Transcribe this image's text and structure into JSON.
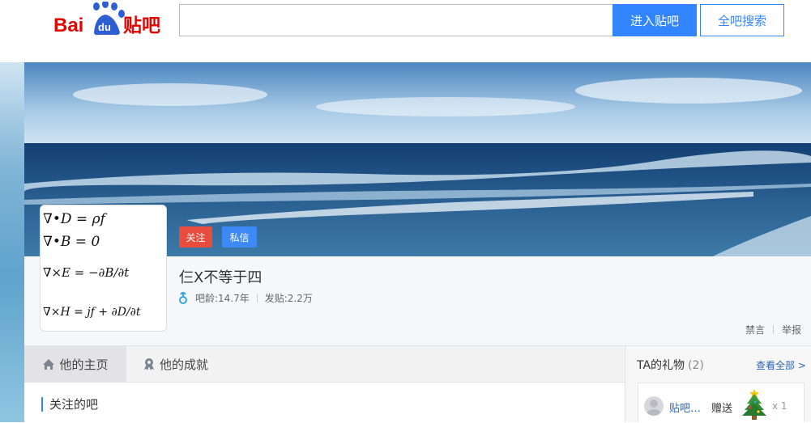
{
  "header": {
    "logo_text": "Bai du 贴吧",
    "search_placeholder": "",
    "enter_button": "进入贴吧",
    "search_all_button": "全吧搜索"
  },
  "profile": {
    "follow_button": "关注",
    "message_button": "私信",
    "username": "仨X不等于四",
    "gender_icon": "male-icon",
    "age": "吧龄:14.7年",
    "posts": "发贴:2.2万",
    "mute": "禁言",
    "report": "举报",
    "avatar_formulas": [
      "∇•D = ρf",
      "∇•B = 0",
      "∇×E = −∂B/∂t",
      "∇×H = jf + ∂D/∂t"
    ]
  },
  "tabs": [
    {
      "label": "他的主页",
      "icon": "home-icon",
      "active": true
    },
    {
      "label": "他的成就",
      "icon": "achievement-icon",
      "active": false
    }
  ],
  "main": {
    "section_title": "关注的吧"
  },
  "gifts": {
    "title": "TA的礼物",
    "count": "(2)",
    "view_all": "查看全部 >",
    "items": [
      {
        "user": "贴吧…",
        "verb": "赠送",
        "gift_icon": "christmas-tree-icon",
        "qty": "x 1"
      }
    ]
  },
  "colors": {
    "accent": "#3385ff",
    "follow": "#e74c3c",
    "message": "#3d8af7",
    "link": "#2d64b3"
  }
}
